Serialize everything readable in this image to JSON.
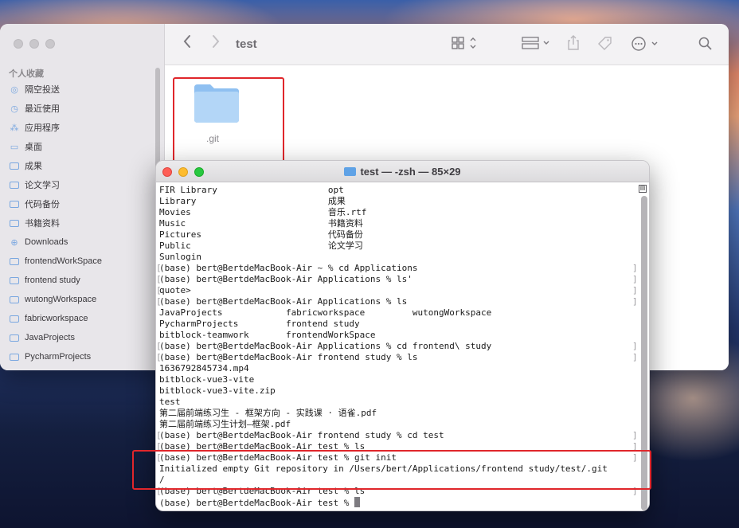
{
  "finder": {
    "title": "test",
    "sidebar_heading": "个人收藏",
    "sidebar_items": [
      {
        "label": "隔空投送",
        "icon": "airdrop-icon"
      },
      {
        "label": "最近使用",
        "icon": "clock-icon"
      },
      {
        "label": "应用程序",
        "icon": "applications-icon"
      },
      {
        "label": "桌面",
        "icon": "desktop-icon"
      },
      {
        "label": "成果",
        "icon": "folder-icon"
      },
      {
        "label": "论文学习",
        "icon": "folder-icon"
      },
      {
        "label": "代码备份",
        "icon": "folder-icon"
      },
      {
        "label": "书籍资料",
        "icon": "folder-icon"
      },
      {
        "label": "Downloads",
        "icon": "download-icon"
      },
      {
        "label": "frontendWorkSpace",
        "icon": "folder-icon"
      },
      {
        "label": "frontend study",
        "icon": "folder-icon"
      },
      {
        "label": "wutongWorkspace",
        "icon": "folder-icon"
      },
      {
        "label": "fabricworkspace",
        "icon": "folder-icon"
      },
      {
        "label": "JavaProjects",
        "icon": "folder-icon"
      },
      {
        "label": "PycharmProjects",
        "icon": "folder-icon"
      }
    ],
    "files": [
      {
        "name": ".git",
        "icon": "folder-icon"
      }
    ]
  },
  "terminal": {
    "title": "test — -zsh — 85×29",
    "lines": [
      {
        "text": "FIR Library                     opt",
        "mark": false
      },
      {
        "text": "Library                         成果",
        "mark": false
      },
      {
        "text": "Movies                          音乐.rtf",
        "mark": false
      },
      {
        "text": "Music                           书籍资料",
        "mark": false
      },
      {
        "text": "Pictures                        代码备份",
        "mark": false
      },
      {
        "text": "Public                          论文学习",
        "mark": false
      },
      {
        "text": "Sunlogin",
        "mark": false
      },
      {
        "text": "(base) bert@BertdeMacBook-Air ~ % cd Applications",
        "mark": true
      },
      {
        "text": "(base) bert@BertdeMacBook-Air Applications % ls'",
        "mark": true
      },
      {
        "text": "quote>",
        "mark": true
      },
      {
        "text": "(base) bert@BertdeMacBook-Air Applications % ls",
        "mark": true
      },
      {
        "text": "JavaProjects            fabricworkspace         wutongWorkspace",
        "mark": false
      },
      {
        "text": "PycharmProjects         frontend study",
        "mark": false
      },
      {
        "text": "bitblock-teamwork       frontendWorkSpace",
        "mark": false
      },
      {
        "text": "(base) bert@BertdeMacBook-Air Applications % cd frontend\\ study",
        "mark": true
      },
      {
        "text": "(base) bert@BertdeMacBook-Air frontend study % ls",
        "mark": true
      },
      {
        "text": "1636792845734.mp4",
        "mark": false
      },
      {
        "text": "bitblock-vue3-vite",
        "mark": false
      },
      {
        "text": "bitblock-vue3-vite.zip",
        "mark": false
      },
      {
        "text": "test",
        "mark": false
      },
      {
        "text": "第二届前端练习生 - 框架方向 - 实践课 · 语雀.pdf",
        "mark": false
      },
      {
        "text": "第二届前端练习生计划—框架.pdf",
        "mark": false
      },
      {
        "text": "(base) bert@BertdeMacBook-Air frontend study % cd test",
        "mark": true
      },
      {
        "text": "(base) bert@BertdeMacBook-Air test % ls",
        "mark": true
      },
      {
        "text": "(base) bert@BertdeMacBook-Air test % git init",
        "mark": true
      },
      {
        "text": "Initialized empty Git repository in /Users/bert/Applications/frontend study/test/.git",
        "mark": false
      },
      {
        "text": "/",
        "mark": false
      },
      {
        "text": "(base) bert@BertdeMacBook-Air test % ls",
        "mark": true
      },
      {
        "text": "(base) bert@BertdeMacBook-Air test % ",
        "mark": false
      }
    ]
  },
  "colors": {
    "highlight": "#e0262b",
    "folder": "#a9cff5",
    "close": "#fe5f57",
    "minimize": "#febc2e",
    "zoom": "#28c840"
  }
}
